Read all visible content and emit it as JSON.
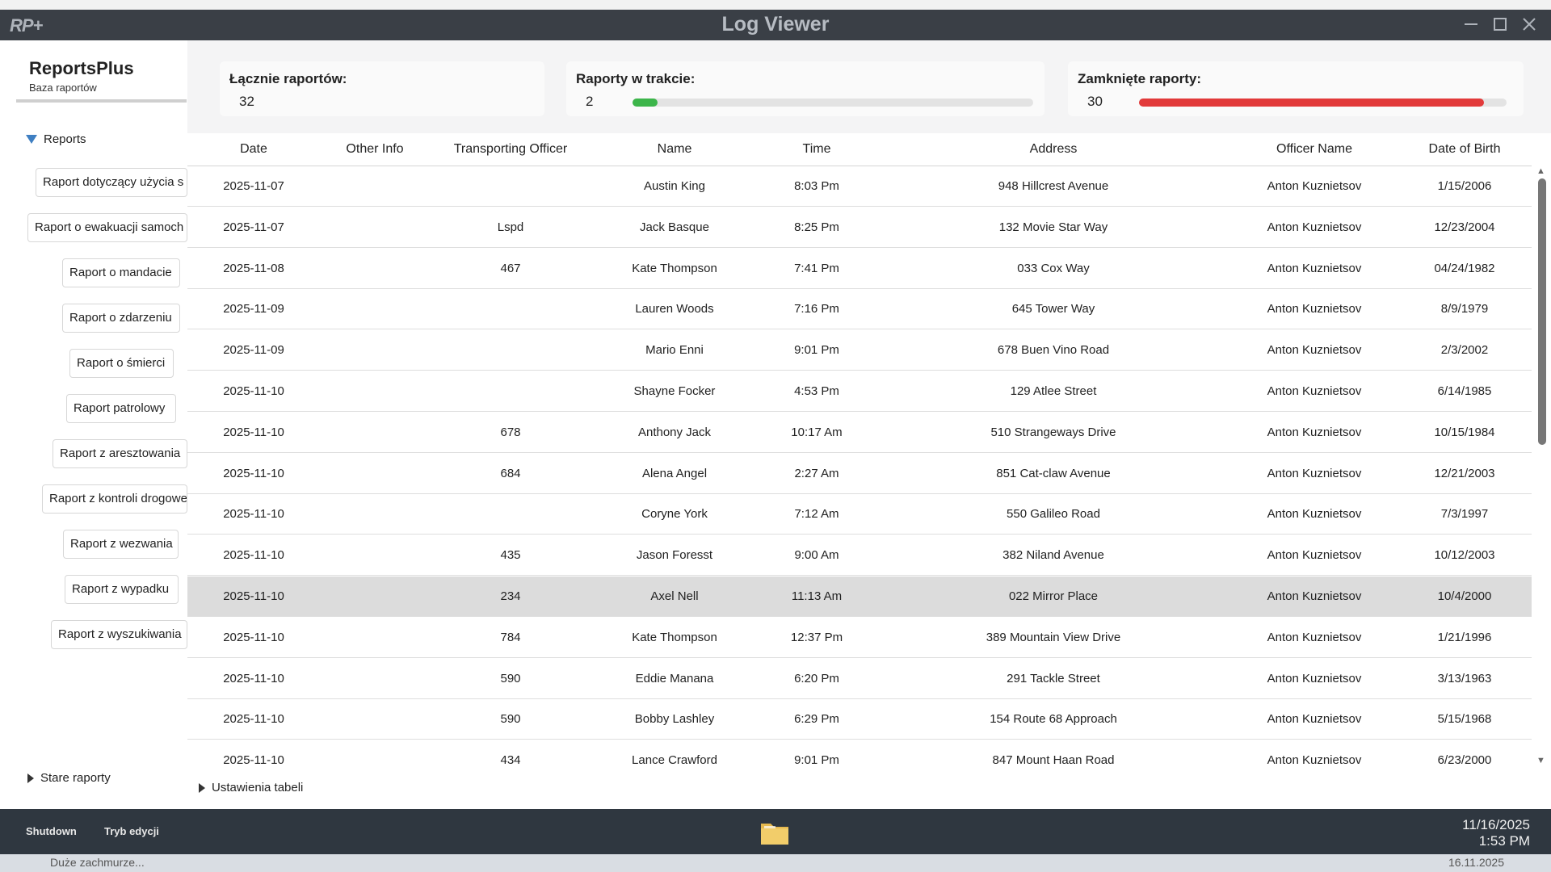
{
  "window": {
    "logo": "RP+",
    "title": "Log Viewer"
  },
  "sidebar": {
    "brand_title": "ReportsPlus",
    "brand_subtitle": "Baza raportów",
    "tree_label": "Reports",
    "items": [
      "Raport dotyczący użycia s",
      "Raport o ewakuacji samoch",
      "Raport o mandacie",
      "Raport o zdarzeniu",
      "Raport o śmierci",
      "Raport patrolowy",
      "Raport z aresztowania",
      "Raport z kontroli drogowe",
      "Raport z wezwania",
      "Raport z wypadku",
      "Raport z wyszukiwania"
    ],
    "old_reports": "Stare raporty"
  },
  "stats": {
    "total": {
      "label": "Łącznie raportów:",
      "value": "32"
    },
    "in_progress": {
      "label": "Raporty w trakcie:",
      "value": "2",
      "fraction": 0.0625,
      "color": "#3cb54a"
    },
    "closed": {
      "label": "Zamknięte raporty:",
      "value": "30",
      "fraction": 0.9375,
      "color": "#e23a3a"
    }
  },
  "table": {
    "columns": [
      "Date",
      "Other Info",
      "Transporting Officer",
      "Name",
      "Time",
      "Address",
      "Officer Name",
      "Date of Birth"
    ],
    "rows": [
      [
        "2025-11-07",
        "",
        "",
        "Austin King",
        "8:03 Pm",
        "948 Hillcrest Avenue",
        "Anton Kuznietsov",
        "1/15/2006"
      ],
      [
        "2025-11-07",
        "",
        "Lspd",
        "Jack Basque",
        "8:25 Pm",
        "132 Movie Star Way",
        "Anton Kuznietsov",
        "12/23/2004"
      ],
      [
        "2025-11-08",
        "",
        "467",
        "Kate Thompson",
        "7:41 Pm",
        "033 Cox Way",
        "Anton Kuznietsov",
        "04/24/1982"
      ],
      [
        "2025-11-09",
        "",
        "",
        "Lauren Woods",
        "7:16 Pm",
        "645 Tower Way",
        "Anton Kuznietsov",
        "8/9/1979"
      ],
      [
        "2025-11-09",
        "",
        "",
        "Mario Enni",
        "9:01 Pm",
        "678 Buen Vino Road",
        "Anton Kuznietsov",
        "2/3/2002"
      ],
      [
        "2025-11-10",
        "",
        "",
        "Shayne Focker",
        "4:53 Pm",
        "129 Atlee Street",
        "Anton Kuznietsov",
        "6/14/1985"
      ],
      [
        "2025-11-10",
        "",
        "678",
        "Anthony Jack",
        "10:17 Am",
        "510 Strangeways Drive",
        "Anton Kuznietsov",
        "10/15/1984"
      ],
      [
        "2025-11-10",
        "",
        "684",
        "Alena Angel",
        "2:27 Am",
        "851 Cat-claw Avenue",
        "Anton Kuznietsov",
        "12/21/2003"
      ],
      [
        "2025-11-10",
        "",
        "",
        "Coryne York",
        "7:12 Am",
        "550 Galileo Road",
        "Anton Kuznietsov",
        "7/3/1997"
      ],
      [
        "2025-11-10",
        "",
        "435",
        "Jason Foresst",
        "9:00 Am",
        "382 Niland Avenue",
        "Anton Kuznietsov",
        "10/12/2003"
      ],
      [
        "2025-11-10",
        "",
        "234",
        "Axel Nell",
        "11:13 Am",
        "022 Mirror Place",
        "Anton Kuznietsov",
        "10/4/2000"
      ],
      [
        "2025-11-10",
        "",
        "784",
        "Kate Thompson",
        "12:37 Pm",
        "389 Mountain View Drive",
        "Anton Kuznietsov",
        "1/21/1996"
      ],
      [
        "2025-11-10",
        "",
        "590",
        "Eddie Manana",
        "6:20 Pm",
        "291 Tackle Street",
        "Anton Kuznietsov",
        "3/13/1963"
      ],
      [
        "2025-11-10",
        "",
        "590",
        "Bobby Lashley",
        "6:29 Pm",
        "154 Route 68 Approach",
        "Anton Kuznietsov",
        "5/15/1968"
      ],
      [
        "2025-11-10",
        "",
        "434",
        "Lance Crawford",
        "9:01 Pm",
        "847 Mount Haan Road",
        "Anton Kuznietsov",
        "6/23/2000"
      ]
    ],
    "selected_row": 10,
    "settings_label": "Ustawienia tabeli"
  },
  "taskbar": {
    "shutdown": "Shutdown",
    "edit_mode": "Tryb edycji",
    "date": "11/16/2025",
    "time": "1:53 PM"
  },
  "os": {
    "left_text": "Duże zachmurze...",
    "right_date": "16.11.2025"
  }
}
